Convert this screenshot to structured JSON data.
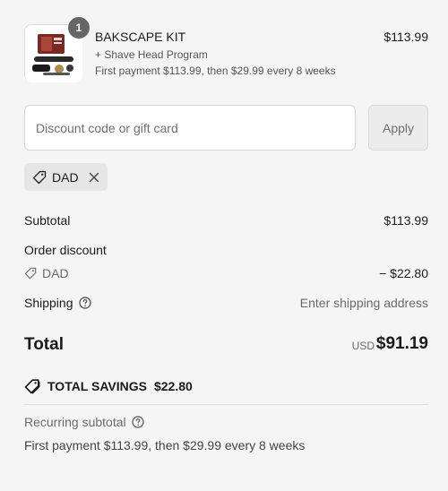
{
  "line_item": {
    "quantity": "1",
    "name": "BAKSCAPE KIT",
    "subtitle": "+ Shave Head Program",
    "plan": "First payment $113.99, then $29.99 every 8 weeks",
    "price": "$113.99",
    "image_icon": "product-kit-photo"
  },
  "discount": {
    "placeholder": "Discount code or gift card",
    "value": "",
    "apply_label": "Apply",
    "applied_code": "DAD",
    "tag_icon": "tag-icon",
    "remove_icon": "close-icon"
  },
  "summary": {
    "subtotal_label": "Subtotal",
    "subtotal_value": "$113.99",
    "order_discount_label": "Order discount",
    "discount_code": "DAD",
    "discount_value": "− $22.80",
    "shipping_label": "Shipping",
    "shipping_value": "Enter shipping address",
    "total_label": "Total",
    "currency": "USD",
    "total_value": "$91.19",
    "savings_label": "TOTAL SAVINGS",
    "savings_value": "$22.80",
    "recurring_label": "Recurring subtotal",
    "recurring_value": "First payment $113.99, then $29.99 every 8 weeks"
  },
  "colors": {
    "background": "#f5f5f5",
    "text": "#1a1a1a",
    "muted": "#6b6b6b",
    "badge": "#666666"
  }
}
